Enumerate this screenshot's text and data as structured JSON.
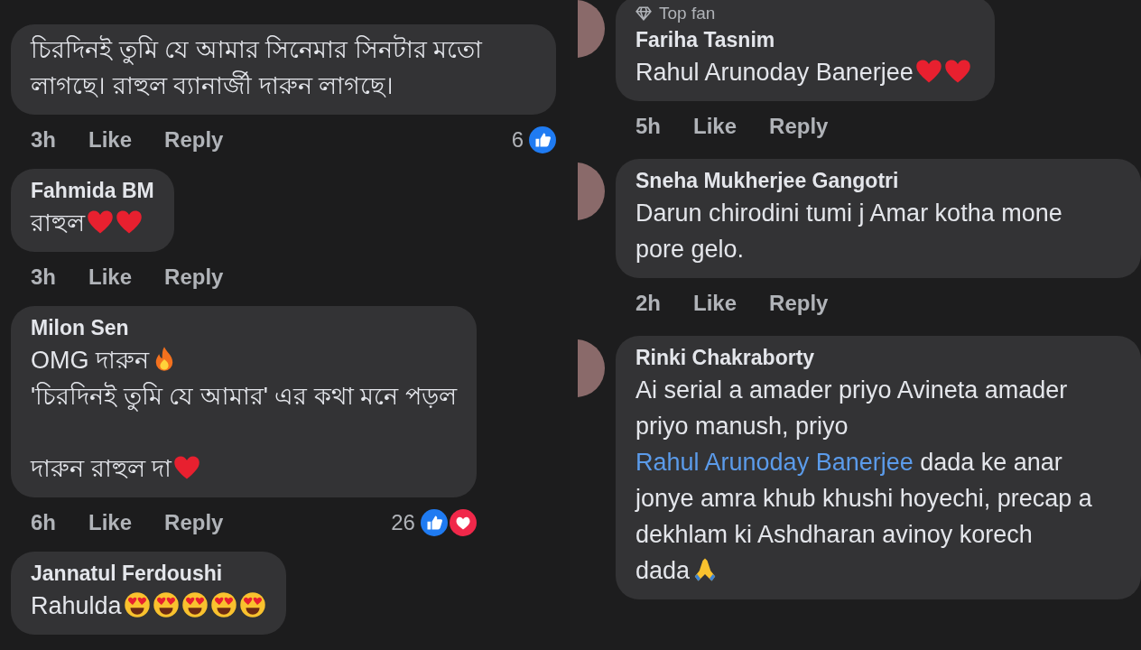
{
  "columns": [
    {
      "comments": [
        {
          "paragraphs": [
            [
              {
                "kind": "text",
                "text": "চিরদিনই তুমি যে আমার সিনেমার সিনটার মতো লাগছে। রাহুল ব্যানার্জী দারুন লাগছে।"
              }
            ]
          ],
          "time": "3h",
          "actions": [
            "Like",
            "Reply"
          ],
          "reaction_count": "6",
          "reactions": [
            {
              "kind": "like"
            }
          ]
        },
        {
          "author": "Fahmida BM",
          "paragraphs": [
            [
              {
                "kind": "text",
                "text": "রাহুল"
              },
              {
                "kind": "heart"
              },
              {
                "kind": "heart"
              }
            ]
          ],
          "time": "3h",
          "actions": [
            "Like",
            "Reply"
          ]
        },
        {
          "author": "Milon Sen",
          "paragraphs": [
            [
              {
                "kind": "text",
                "text": "OMG দারুন"
              },
              {
                "kind": "fire"
              },
              {
                "kind": "break"
              },
              {
                "kind": "text",
                "text": "'চিরদিনই তুমি যে আমার' এর কথা মনে পড়ল"
              }
            ],
            [
              {
                "kind": "text",
                "text": "দারুন রাহুল দা"
              },
              {
                "kind": "heart"
              }
            ]
          ],
          "time": "6h",
          "actions": [
            "Like",
            "Reply"
          ],
          "reaction_count": "26",
          "reactions": [
            {
              "kind": "like"
            },
            {
              "kind": "love"
            }
          ]
        },
        {
          "author": "Jannatul Ferdoushi",
          "paragraphs": [
            [
              {
                "kind": "text",
                "text": "Rahulda"
              },
              {
                "kind": "heart-eyes"
              },
              {
                "kind": "heart-eyes"
              },
              {
                "kind": "heart-eyes"
              },
              {
                "kind": "heart-eyes"
              },
              {
                "kind": "heart-eyes"
              }
            ]
          ]
        }
      ]
    },
    {
      "comments": [
        {
          "avatar": true,
          "badge": "Top fan",
          "author": "Fariha Tasnim",
          "paragraphs": [
            [
              {
                "kind": "text",
                "text": "Rahul Arunoday Banerjee"
              },
              {
                "kind": "heart"
              },
              {
                "kind": "heart"
              }
            ]
          ],
          "time": "5h",
          "actions": [
            "Like",
            "Reply"
          ]
        },
        {
          "avatar": true,
          "author": "Sneha Mukherjee Gangotri",
          "paragraphs": [
            [
              {
                "kind": "text",
                "text": "Darun chirodini tumi j Amar kotha mone pore gelo."
              }
            ]
          ],
          "time": "2h",
          "actions": [
            "Like",
            "Reply"
          ]
        },
        {
          "avatar": true,
          "author": "Rinki Chakraborty",
          "paragraphs": [
            [
              {
                "kind": "text",
                "text": "Ai serial a amader priyo Avineta amader priyo manush, priyo "
              },
              {
                "kind": "link",
                "text": "Rahul Arunoday Banerjee"
              },
              {
                "kind": "text",
                "text": "  dada ke anar jonye amra khub khushi hoyechi,  precap a dekhlam ki Ashdharan avinoy korech"
              },
              {
                "kind": "break"
              },
              {
                "kind": "text",
                "text": "dada"
              },
              {
                "kind": "pray"
              }
            ]
          ]
        }
      ]
    }
  ]
}
